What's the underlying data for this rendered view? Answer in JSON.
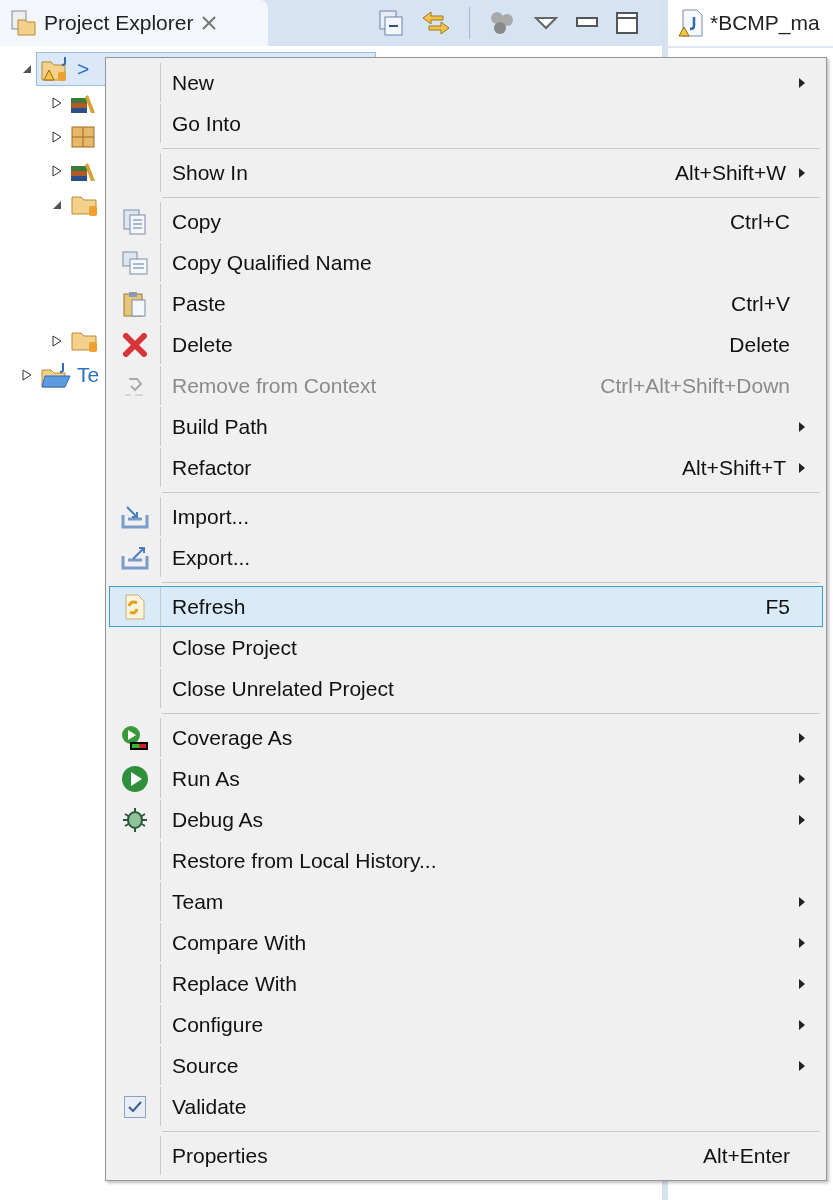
{
  "explorer": {
    "title": "Project Explorer",
    "tree": [
      {
        "label": ">",
        "selected": true,
        "expanded": true,
        "children": [
          {
            "expanded": false,
            "kind": "library"
          },
          {
            "expanded": false,
            "kind": "package"
          },
          {
            "expanded": false,
            "kind": "library"
          },
          {
            "expanded": true,
            "kind": "folder"
          },
          {
            "expanded": false,
            "kind": "folder"
          }
        ]
      },
      {
        "label": "Te",
        "selected": false,
        "expanded": false,
        "kind": "project"
      }
    ]
  },
  "editor": {
    "tab": "*BCMP_ma"
  },
  "menu": [
    {
      "kind": "item",
      "label": "New",
      "submenu": true,
      "disabled": false,
      "selected": false
    },
    {
      "kind": "item",
      "label": "Go Into",
      "submenu": false,
      "disabled": false,
      "selected": false
    },
    {
      "kind": "separator"
    },
    {
      "kind": "item",
      "label": "Show In",
      "shortcut": "Alt+Shift+W",
      "submenu": true,
      "disabled": false,
      "selected": false
    },
    {
      "kind": "separator"
    },
    {
      "kind": "item",
      "label": "Copy",
      "shortcut": "Ctrl+C",
      "submenu": false,
      "disabled": false,
      "selected": false
    },
    {
      "kind": "item",
      "label": "Copy Qualified Name",
      "submenu": false,
      "disabled": false,
      "selected": false
    },
    {
      "kind": "item",
      "label": "Paste",
      "shortcut": "Ctrl+V",
      "submenu": false,
      "disabled": false,
      "selected": false
    },
    {
      "kind": "item",
      "label": "Delete",
      "shortcut": "Delete",
      "submenu": false,
      "disabled": false,
      "selected": false
    },
    {
      "kind": "item",
      "label": "Remove from Context",
      "shortcut": "Ctrl+Alt+Shift+Down",
      "submenu": false,
      "disabled": true,
      "selected": false
    },
    {
      "kind": "item",
      "label": "Build Path",
      "submenu": true,
      "disabled": false,
      "selected": false
    },
    {
      "kind": "item",
      "label": "Refactor",
      "shortcut": "Alt+Shift+T",
      "submenu": true,
      "disabled": false,
      "selected": false
    },
    {
      "kind": "separator"
    },
    {
      "kind": "item",
      "label": "Import...",
      "submenu": false,
      "disabled": false,
      "selected": false
    },
    {
      "kind": "item",
      "label": "Export...",
      "submenu": false,
      "disabled": false,
      "selected": false
    },
    {
      "kind": "separator"
    },
    {
      "kind": "item",
      "label": "Refresh",
      "shortcut": "F5",
      "submenu": false,
      "disabled": false,
      "selected": true
    },
    {
      "kind": "item",
      "label": "Close Project",
      "submenu": false,
      "disabled": false,
      "selected": false
    },
    {
      "kind": "item",
      "label": "Close Unrelated Project",
      "submenu": false,
      "disabled": false,
      "selected": false
    },
    {
      "kind": "separator"
    },
    {
      "kind": "item",
      "label": "Coverage As",
      "submenu": true,
      "disabled": false,
      "selected": false
    },
    {
      "kind": "item",
      "label": "Run As",
      "submenu": true,
      "disabled": false,
      "selected": false
    },
    {
      "kind": "item",
      "label": "Debug As",
      "submenu": true,
      "disabled": false,
      "selected": false
    },
    {
      "kind": "item",
      "label": "Restore from Local History...",
      "submenu": false,
      "disabled": false,
      "selected": false
    },
    {
      "kind": "item",
      "label": "Team",
      "submenu": true,
      "disabled": false,
      "selected": false
    },
    {
      "kind": "item",
      "label": "Compare With",
      "submenu": true,
      "disabled": false,
      "selected": false
    },
    {
      "kind": "item",
      "label": "Replace With",
      "submenu": true,
      "disabled": false,
      "selected": false
    },
    {
      "kind": "item",
      "label": "Configure",
      "submenu": true,
      "disabled": false,
      "selected": false
    },
    {
      "kind": "item",
      "label": "Source",
      "submenu": true,
      "disabled": false,
      "selected": false
    },
    {
      "kind": "check",
      "label": "Validate",
      "checked": true,
      "submenu": false,
      "disabled": false,
      "selected": false
    },
    {
      "kind": "separator"
    },
    {
      "kind": "item",
      "label": "Properties",
      "shortcut": "Alt+Enter",
      "submenu": false,
      "disabled": false,
      "selected": false
    }
  ]
}
